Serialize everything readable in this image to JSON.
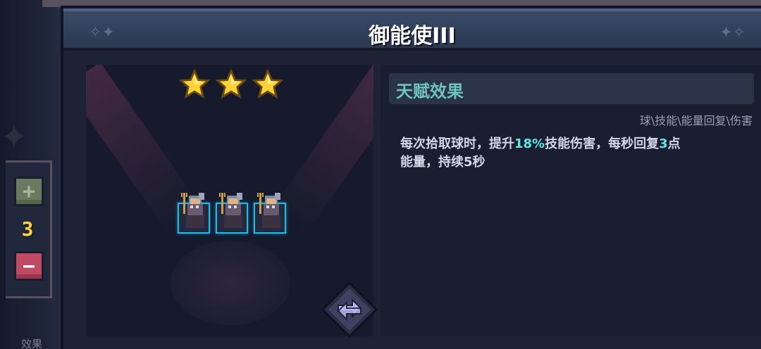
{
  "title": "御能使III",
  "stars": {
    "count": 3,
    "color": "#ffd23a"
  },
  "count_panel": {
    "plus_symbol": "+",
    "value": "3",
    "minus_symbol": "−"
  },
  "units": [
    {
      "name": "trident-warrior"
    },
    {
      "name": "trident-warrior"
    },
    {
      "name": "trident-warrior"
    }
  ],
  "info": {
    "header": "天赋效果",
    "tags": "球\\技能\\能量回复\\伤害",
    "desc": {
      "p1": "每次拾取球时，提升",
      "v1": "18%",
      "p2": "技能伤害，每秒回复",
      "v2": "3",
      "p3": "点",
      "p4": "能量，持续5秒"
    }
  },
  "background": {
    "bottom_label": "效果"
  },
  "colors": {
    "accent": "#5fe6e6",
    "header_text": "#6fc2c2",
    "slot_border": "#29b8e0",
    "minus_button": "#c04a64",
    "plus_button": "#6a7a5e"
  },
  "icons": [
    "star-icon",
    "plus-icon",
    "minus-icon",
    "swap-icon"
  ]
}
